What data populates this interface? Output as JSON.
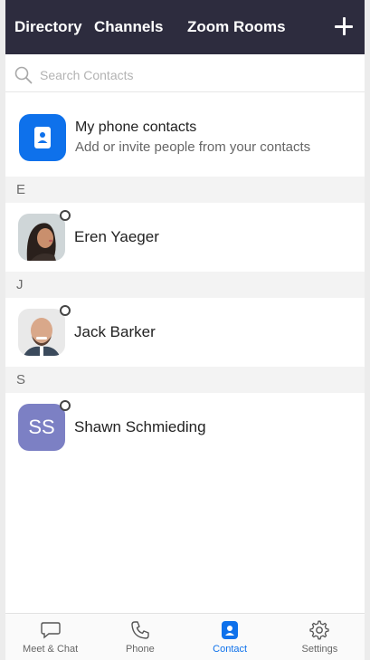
{
  "header": {
    "tabs": [
      {
        "label": "Directory"
      },
      {
        "label": "Channels"
      },
      {
        "label": "Zoom Rooms"
      }
    ]
  },
  "search": {
    "placeholder": "Search Contacts"
  },
  "phone_contacts": {
    "title": "My phone contacts",
    "subtitle": "Add or invite people from your contacts"
  },
  "sections": [
    {
      "letter": "E",
      "contacts": [
        {
          "name": "Eren Yaeger",
          "presence": "offline"
        }
      ]
    },
    {
      "letter": "J",
      "contacts": [
        {
          "name": "Jack Barker",
          "presence": "offline"
        }
      ]
    },
    {
      "letter": "S",
      "contacts": [
        {
          "name": "Shawn Schmieding",
          "initials": "SS",
          "presence": "offline"
        }
      ]
    }
  ],
  "bottom_nav": {
    "items": [
      {
        "label": "Meet & Chat",
        "icon": "chat-bubble-icon"
      },
      {
        "label": "Phone",
        "icon": "phone-icon"
      },
      {
        "label": "Contact",
        "icon": "contact-icon",
        "active": true
      },
      {
        "label": "Settings",
        "icon": "gear-icon"
      }
    ]
  },
  "colors": {
    "header_bg": "#2d2c3e",
    "accent": "#0e71eb",
    "initials_avatar": "#7c80c4",
    "section_bg": "#f3f3f3"
  }
}
